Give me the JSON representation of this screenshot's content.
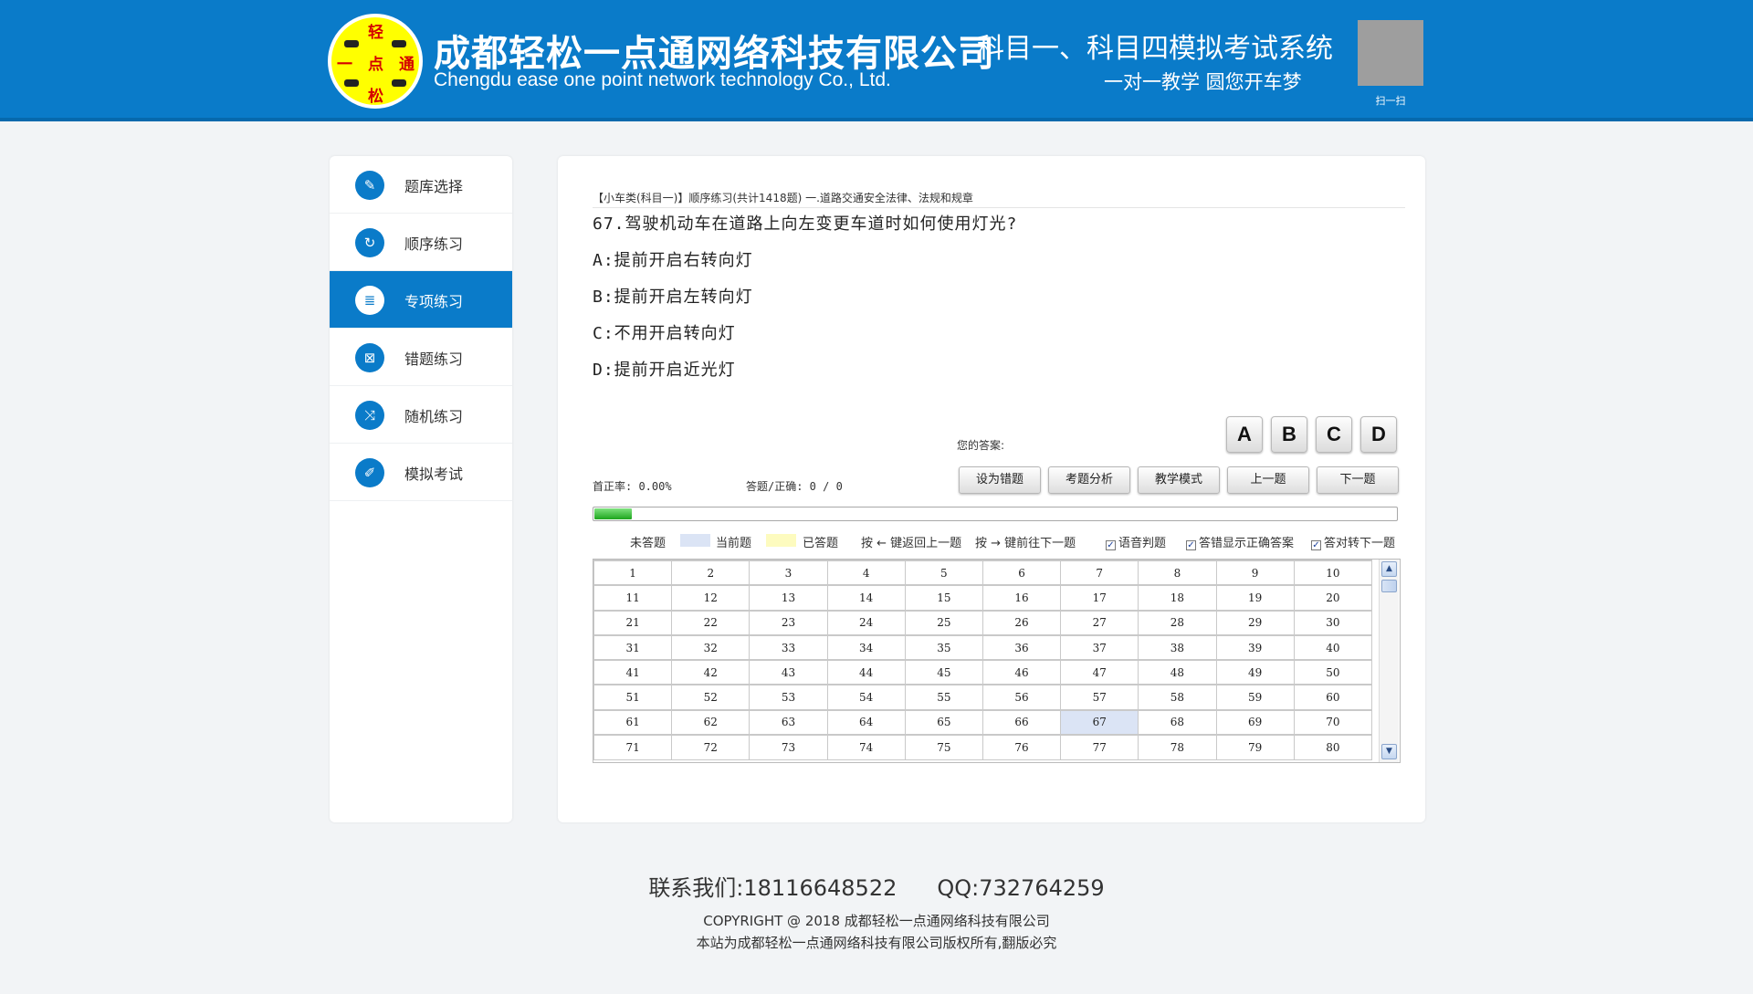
{
  "header": {
    "logo_chars": [
      "轻",
      "一",
      "点",
      "通",
      "松"
    ],
    "company_cn": "成都轻松一点通网络科技有限公司",
    "company_en": "Chengdu ease one point network technology Co., Ltd.",
    "system_title": "科目一、科目四模拟考试系统",
    "slogan": "一对一教学 圆您开车梦",
    "qr_label": "扫一扫",
    "brand_color": "#0a7bc9"
  },
  "sidebar": {
    "items": [
      {
        "label": "题库选择",
        "icon": "edit-icon",
        "glyph": "✎",
        "active": false
      },
      {
        "label": "顺序练习",
        "icon": "refresh-icon",
        "glyph": "↻",
        "active": false
      },
      {
        "label": "专项练习",
        "icon": "list-icon",
        "glyph": "≣",
        "active": true
      },
      {
        "label": "错题练习",
        "icon": "wrong-icon",
        "glyph": "⊠",
        "active": false
      },
      {
        "label": "随机练习",
        "icon": "shuffle-icon",
        "glyph": "⤨",
        "active": false
      },
      {
        "label": "模拟考试",
        "icon": "pencil-icon",
        "glyph": "✐",
        "active": false
      }
    ]
  },
  "exam": {
    "breadcrumb": "【小车类(科目一)】顺序练习(共计1418题) 一.道路交通安全法律、法规和规章",
    "question": "67.驾驶机动车在道路上向左变更车道时如何使用灯光?",
    "options": [
      "A:提前开启右转向灯",
      "B:提前开启左转向灯",
      "C:不用开启转向灯",
      "D:提前开启近光灯"
    ],
    "answer_label": "您的答案:",
    "answer_buttons": [
      "A",
      "B",
      "C",
      "D"
    ],
    "accuracy": "首正率: 0.00%",
    "answered": "答题/正确: 0 / 0",
    "controls": [
      "设为错题",
      "考题分析",
      "教学模式",
      "上一题",
      "下一题"
    ],
    "progress_fraction": 0.047,
    "legend": {
      "unanswered": "未答题",
      "current": "当前题",
      "answered": "已答题",
      "prev_hint": "按 ← 键返回上一题",
      "next_hint": "按 → 键前往下一题"
    },
    "legend_colors": {
      "current": "#dbe4f5",
      "answered": "#fdfbbf"
    },
    "checkboxes": [
      "语音判题",
      "答错显示正确答案",
      "答对转下一题"
    ],
    "current_question": 67,
    "grid_rows": [
      [
        "1",
        "2",
        "3",
        "4",
        "5",
        "6",
        "7",
        "8",
        "9",
        "10"
      ],
      [
        "11",
        "12",
        "13",
        "14",
        "15",
        "16",
        "17",
        "18",
        "19",
        "20"
      ],
      [
        "21",
        "22",
        "23",
        "24",
        "25",
        "26",
        "27",
        "28",
        "29",
        "30"
      ],
      [
        "31",
        "32",
        "33",
        "34",
        "35",
        "36",
        "37",
        "38",
        "39",
        "40"
      ],
      [
        "41",
        "42",
        "43",
        "44",
        "45",
        "46",
        "47",
        "48",
        "49",
        "50"
      ],
      [
        "51",
        "52",
        "53",
        "54",
        "55",
        "56",
        "57",
        "58",
        "59",
        "60"
      ],
      [
        "61",
        "62",
        "63",
        "64",
        "65",
        "66",
        "67",
        "68",
        "69",
        "70"
      ],
      [
        "71",
        "72",
        "73",
        "74",
        "75",
        "76",
        "77",
        "78",
        "79",
        "80"
      ]
    ]
  },
  "footer": {
    "phone": "联系我们:18116648522",
    "qq": "QQ:732764259",
    "copyright": "COPYRIGHT @ 2018 成都轻松一点通网络科技有限公司",
    "rights": "本站为成都轻松一点通网络科技有限公司版权所有,翻版必究"
  }
}
